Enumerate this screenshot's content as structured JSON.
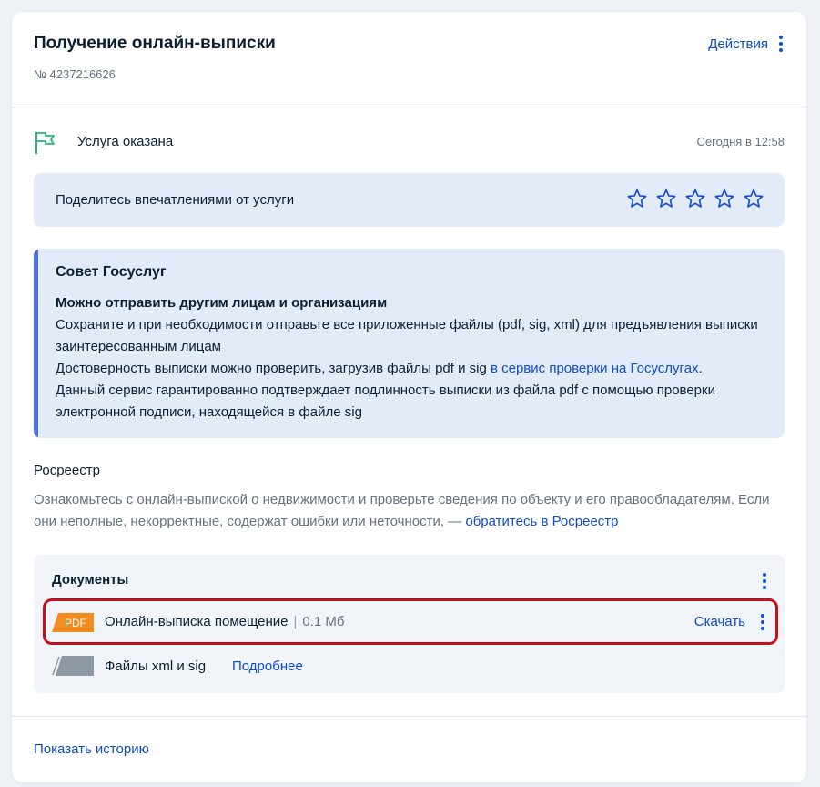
{
  "header": {
    "title": "Получение онлайн-выписки",
    "number": "№ 4237216626",
    "actions_label": "Действия"
  },
  "status": {
    "text": "Услуга оказана",
    "time": "Сегодня в 12:58",
    "icon": "flag-icon"
  },
  "rating": {
    "prompt": "Поделитесь впечатлениями от услуги",
    "max_stars": 5,
    "selected": 0
  },
  "advice": {
    "title": "Совет Госуслуг",
    "subtitle": "Можно отправить другим лицам и организациям",
    "line1": "Сохраните и при необходимости отправьте все приложенные файлы (pdf, sig, xml) для предъявления выписки заинтересованным лицам",
    "line2_prefix": "Достоверность выписки можно проверить, загрузив файлы pdf и sig ",
    "line2_link": "в сервис проверки на Госуслугах",
    "line2_suffix": ".",
    "line3": "Данный сервис гарантированно подтверждает подлинность выписки из файла pdf с помощью проверки электронной подписи, находящейся в файле sig"
  },
  "org": {
    "name": "Росреестр",
    "text": "Ознакомьтесь с онлайн-выпиской о недвижимости и проверьте сведения по объекту и его правообладателям. Если они неполные, некорректные, содержат ошибки или неточности, — ",
    "link": "обратитесь в Росреестр"
  },
  "documents": {
    "title": "Документы",
    "file": {
      "badge": "PDF",
      "name": "Онлайн-выписка помещение",
      "separator": "|",
      "size": "0.1 Мб",
      "download_label": "Скачать"
    },
    "extra": {
      "name": "Файлы xml и sig",
      "more_label": "Подробнее"
    }
  },
  "footer": {
    "history_label": "Показать историю"
  },
  "colors": {
    "accent": "#0d4cd3",
    "status_green": "#2bb673",
    "pdf_orange": "#f28c1f",
    "highlight_red": "#c4101e",
    "panel_blue": "#e4ebf8"
  }
}
